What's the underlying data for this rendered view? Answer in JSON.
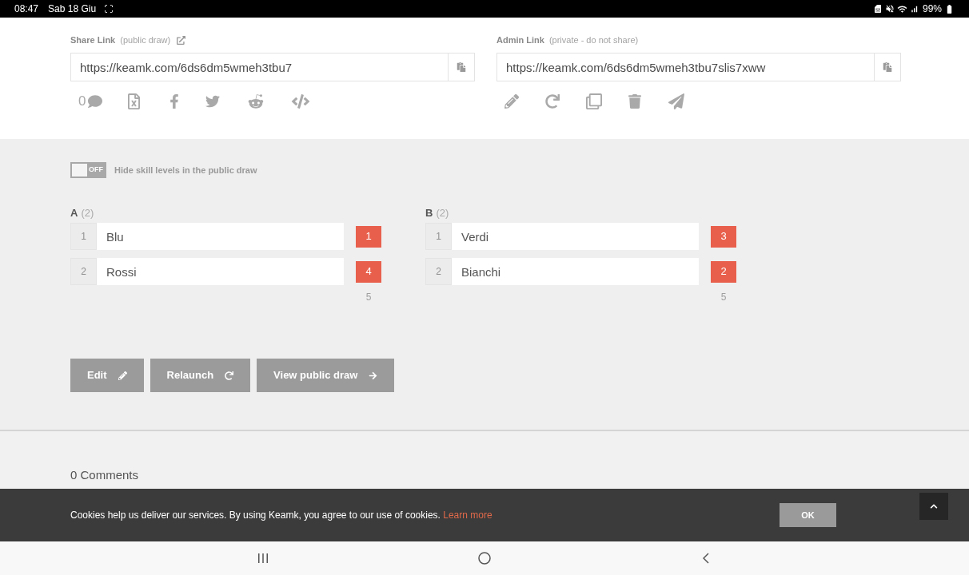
{
  "status_bar": {
    "time": "08:47",
    "date": "Sab 18 Giu",
    "battery": "99%"
  },
  "share_link": {
    "label": "Share Link",
    "note": "(public draw)",
    "value": "https://keamk.com/6ds6dm5wmeh3tbu7",
    "comment_count": "0"
  },
  "admin_link": {
    "label": "Admin Link",
    "note": "(private - do not share)",
    "value": "https://keamk.com/6ds6dm5wmeh3tbu7slis7xww"
  },
  "hide_skill_toggle": {
    "label": "Hide skill levels in the public draw",
    "state_text": "OFF",
    "on": false
  },
  "teams": [
    {
      "name": "A",
      "count": "(2)",
      "players": [
        {
          "index": "1",
          "name": "Blu",
          "skill": "1"
        },
        {
          "index": "2",
          "name": "Rossi",
          "skill": "4"
        }
      ],
      "total": "5"
    },
    {
      "name": "B",
      "count": "(2)",
      "players": [
        {
          "index": "1",
          "name": "Verdi",
          "skill": "3"
        },
        {
          "index": "2",
          "name": "Bianchi",
          "skill": "2"
        }
      ],
      "total": "5"
    }
  ],
  "buttons": [
    {
      "label": "Edit",
      "kind": "edit"
    },
    {
      "label": "Relaunch",
      "kind": "relaunch"
    },
    {
      "label": "View public draw",
      "kind": "view"
    }
  ],
  "comments": {
    "title": "0 Comments"
  },
  "cookie_bar": {
    "text": "Cookies help us deliver our services. By using Keamk, you agree to our use of cookies.",
    "link": "Learn more",
    "button": "OK"
  }
}
